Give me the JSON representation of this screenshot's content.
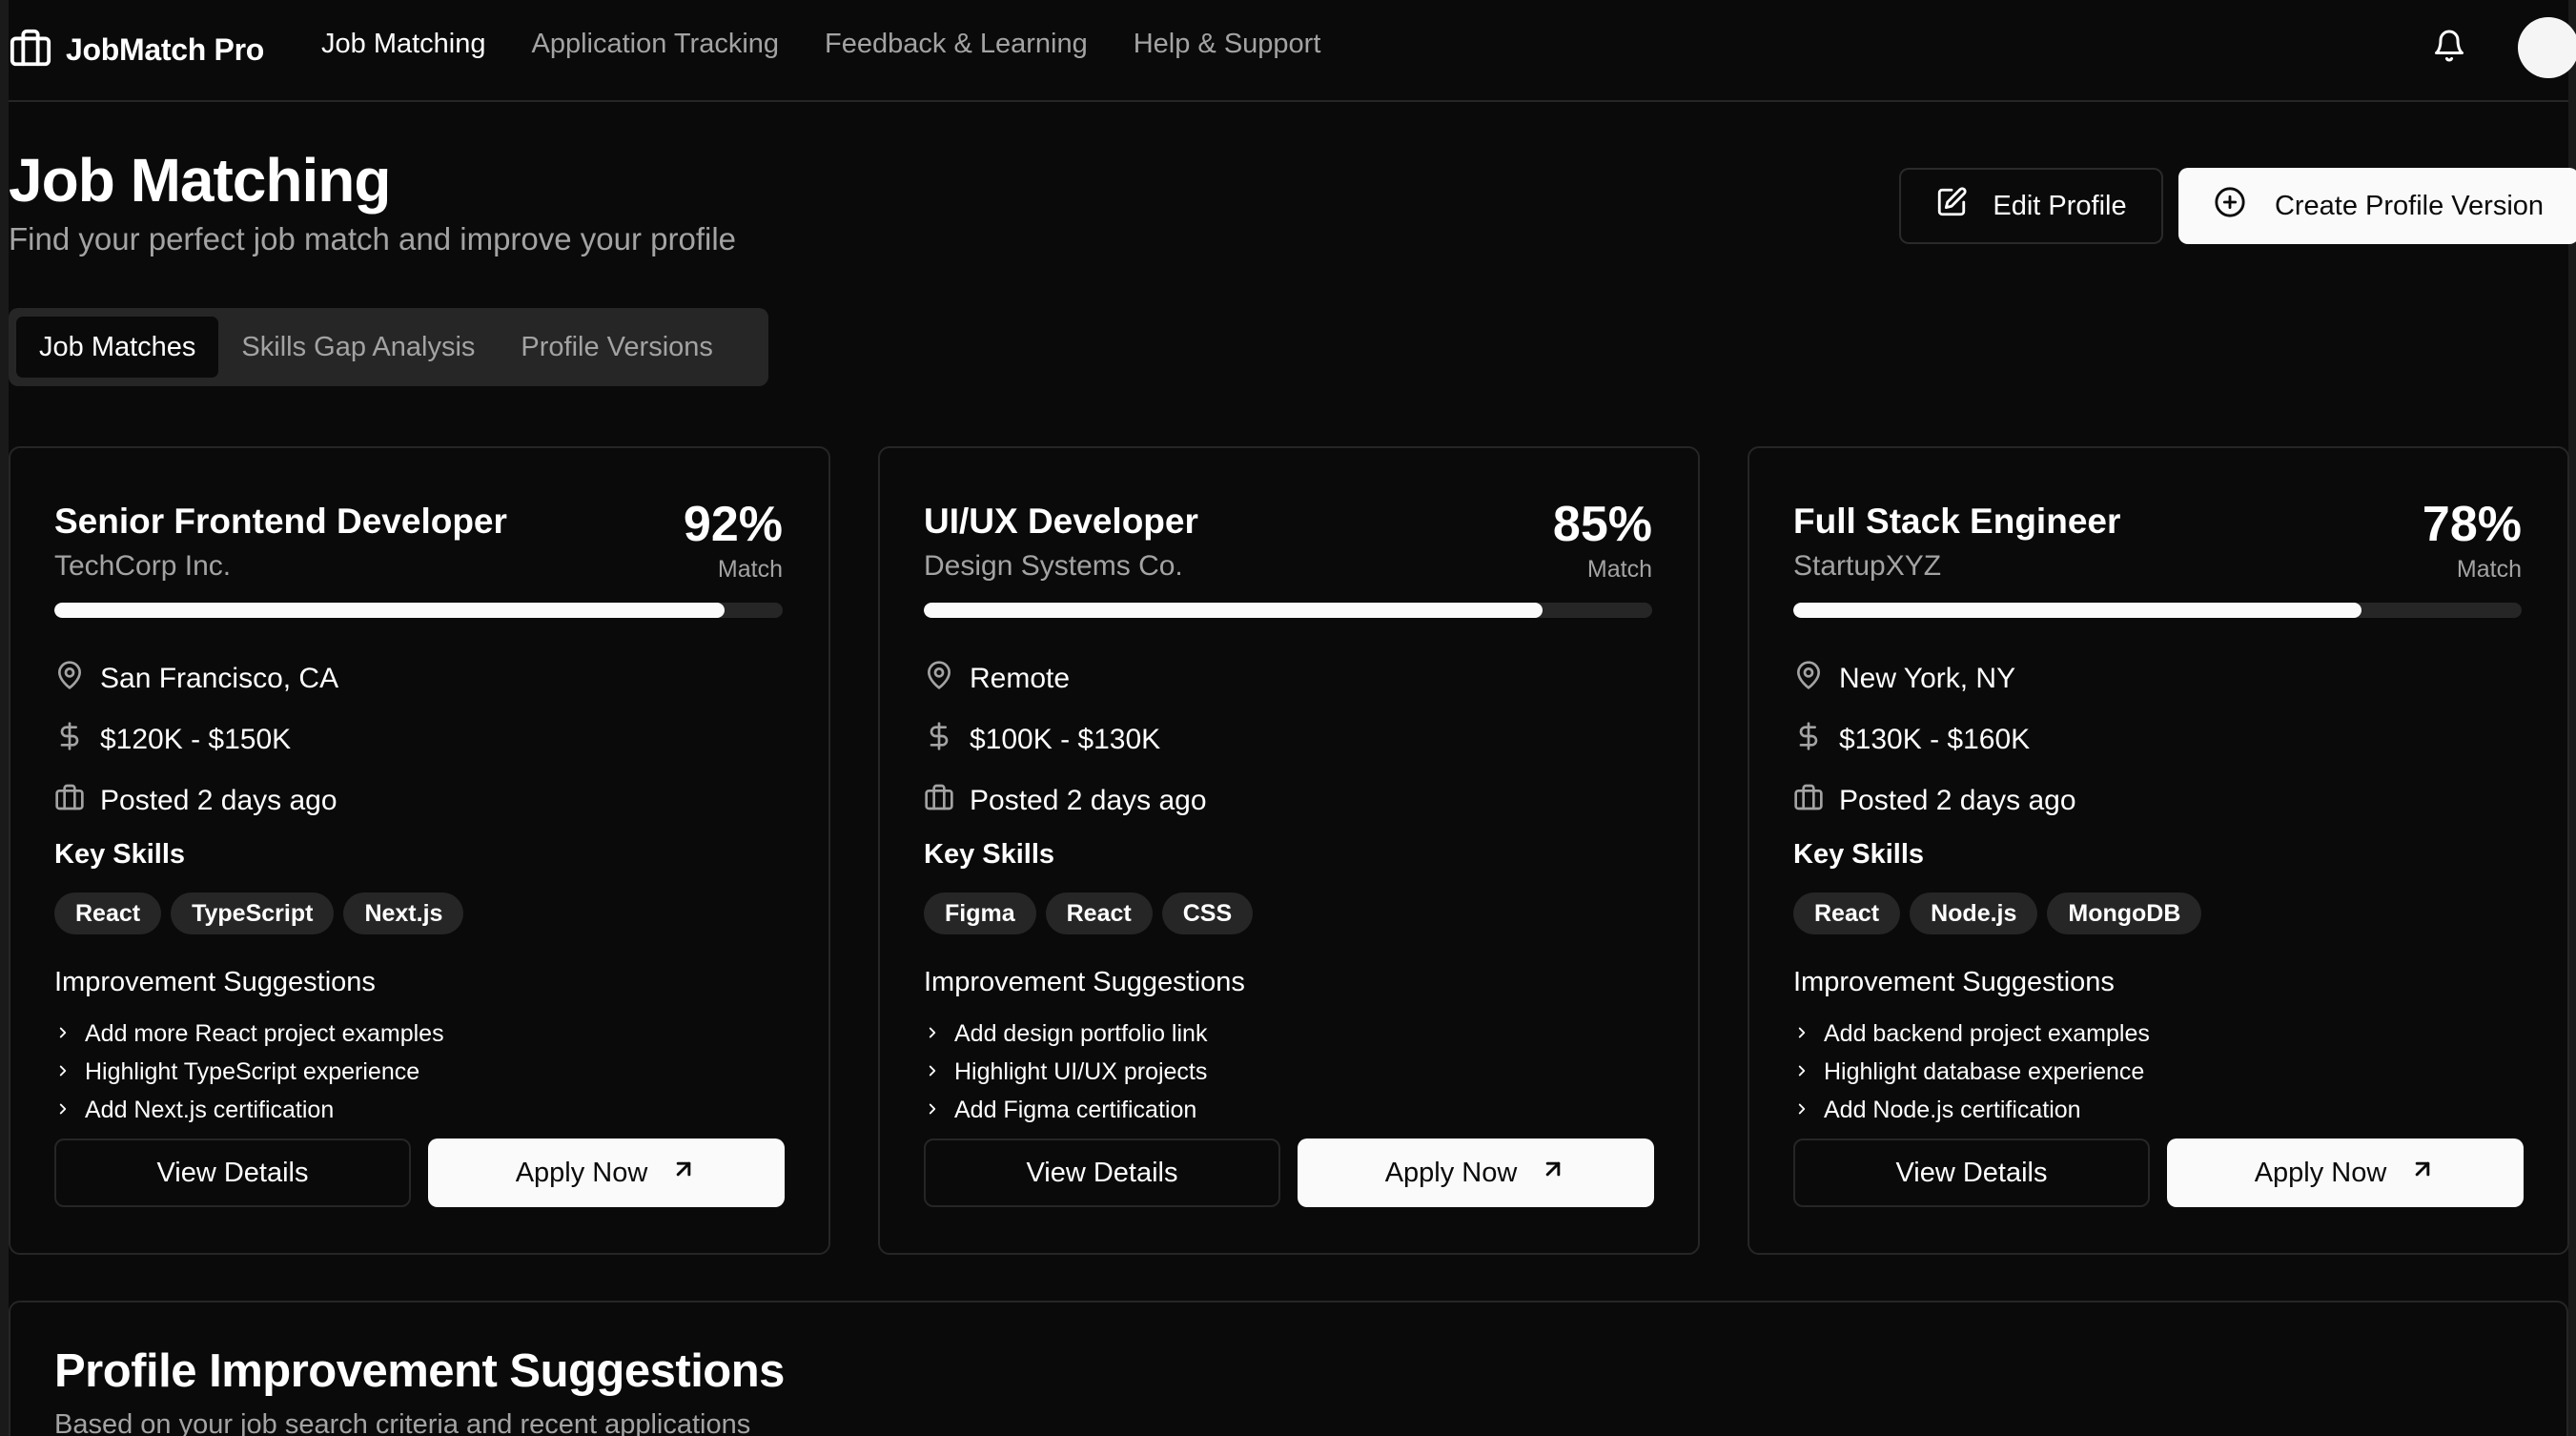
{
  "app": {
    "name": "JobMatch Pro"
  },
  "nav": {
    "links": [
      "Job Matching",
      "Application Tracking",
      "Feedback & Learning",
      "Help & Support"
    ],
    "active_index": 0
  },
  "header": {
    "title": "Job Matching",
    "subtitle": "Find your perfect job match and improve your profile",
    "edit_profile_label": "Edit Profile",
    "create_version_label": "Create Profile Version"
  },
  "tabs": {
    "items": [
      "Job Matches",
      "Skills Gap Analysis",
      "Profile Versions"
    ],
    "active_index": 0
  },
  "jobs": [
    {
      "title": "Senior Frontend Developer",
      "company": "TechCorp Inc.",
      "match_percent": "92%",
      "match_value": 92,
      "match_label": "Match",
      "location": "San Francisco, CA",
      "salary": "$120K - $150K",
      "posted": "Posted 2 days ago",
      "skills_heading": "Key Skills",
      "skills": [
        "React",
        "TypeScript",
        "Next.js"
      ],
      "suggestions_heading": "Improvement Suggestions",
      "suggestions": [
        "Add more React project examples",
        "Highlight TypeScript experience",
        "Add Next.js certification"
      ],
      "view_label": "View Details",
      "apply_label": "Apply Now"
    },
    {
      "title": "UI/UX Developer",
      "company": "Design Systems Co.",
      "match_percent": "85%",
      "match_value": 85,
      "match_label": "Match",
      "location": "Remote",
      "salary": "$100K - $130K",
      "posted": "Posted 2 days ago",
      "skills_heading": "Key Skills",
      "skills": [
        "Figma",
        "React",
        "CSS"
      ],
      "suggestions_heading": "Improvement Suggestions",
      "suggestions": [
        "Add design portfolio link",
        "Highlight UI/UX projects",
        "Add Figma certification"
      ],
      "view_label": "View Details",
      "apply_label": "Apply Now"
    },
    {
      "title": "Full Stack Engineer",
      "company": "StartupXYZ",
      "match_percent": "78%",
      "match_value": 78,
      "match_label": "Match",
      "location": "New York, NY",
      "salary": "$130K - $160K",
      "posted": "Posted 2 days ago",
      "skills_heading": "Key Skills",
      "skills": [
        "React",
        "Node.js",
        "MongoDB"
      ],
      "suggestions_heading": "Improvement Suggestions",
      "suggestions": [
        "Add backend project examples",
        "Highlight database experience",
        "Add Node.js certification"
      ],
      "view_label": "View Details",
      "apply_label": "Apply Now"
    }
  ],
  "improvement_panel": {
    "title": "Profile Improvement Suggestions",
    "subtitle": "Based on your job search criteria and recent applications"
  },
  "colors": {
    "background": "#0a0a0a",
    "border": "#262626",
    "muted_text": "#a3a3a3",
    "primary_button": "#fafafa",
    "chip_bg": "#262626"
  }
}
